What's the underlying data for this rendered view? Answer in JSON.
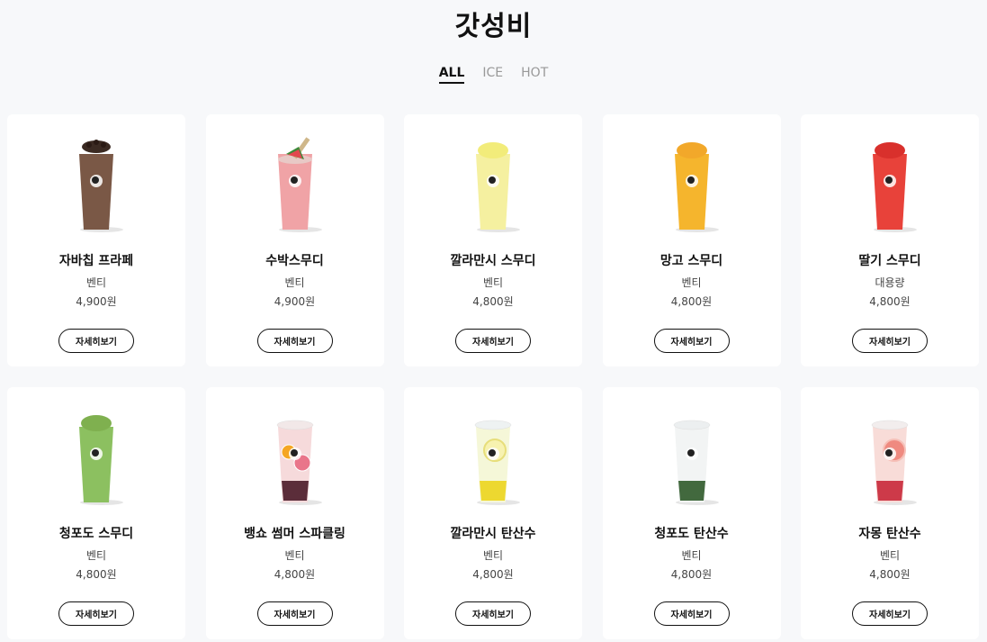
{
  "page": {
    "title": "갓성비"
  },
  "tabs": [
    {
      "label": "ALL",
      "active": true
    },
    {
      "label": "ICE",
      "active": false
    },
    {
      "label": "HOT",
      "active": false
    }
  ],
  "products": [
    {
      "name": "자바칩 프라페",
      "size": "벤티",
      "price": "4,900원",
      "button": "자세히보기",
      "icon": "frappe-cup-icon",
      "color": "#7a5846",
      "top": "#3b2a22",
      "accent": "#5c3e30"
    },
    {
      "name": "수박스무디",
      "size": "벤티",
      "price": "4,900원",
      "button": "자세히보기",
      "icon": "watermelon-smoothie-cup-icon",
      "color": "#f0a3a6",
      "top": "#e8c9c6",
      "accent": "#ef8a8e"
    },
    {
      "name": "깔라만시 스무디",
      "size": "벤티",
      "price": "4,800원",
      "button": "자세히보기",
      "icon": "calamansi-smoothie-cup-icon",
      "color": "#f5f0a0",
      "top": "#f2ec7a",
      "accent": "#efe88a"
    },
    {
      "name": "망고 스무디",
      "size": "벤티",
      "price": "4,800원",
      "button": "자세히보기",
      "icon": "mango-smoothie-cup-icon",
      "color": "#f5b52d",
      "top": "#f2a82a",
      "accent": "#f0a020"
    },
    {
      "name": "딸기 스무디",
      "size": "대용량",
      "price": "4,800원",
      "button": "자세히보기",
      "icon": "strawberry-smoothie-cup-icon",
      "color": "#e8423a",
      "top": "#d9302c",
      "accent": "#e2352e"
    },
    {
      "name": "청포도 스무디",
      "size": "벤티",
      "price": "4,800원",
      "button": "자세히보기",
      "icon": "green-grape-smoothie-cup-icon",
      "color": "#8cc060",
      "top": "#7fb04f",
      "accent": "#6fa040"
    },
    {
      "name": "뱅쇼 썸머 스파클링",
      "size": "벤티",
      "price": "4,800원",
      "button": "자세히보기",
      "icon": "vin-chaud-sparkling-cup-icon",
      "color": "#f6dadb",
      "top": "#f2e8e8",
      "accent": "#4a1a28"
    },
    {
      "name": "깔라만시 탄산수",
      "size": "벤티",
      "price": "4,800원",
      "button": "자세히보기",
      "icon": "calamansi-soda-cup-icon",
      "color": "#f5f7d8",
      "top": "#eef2f2",
      "accent": "#ecd41e"
    },
    {
      "name": "청포도 탄산수",
      "size": "벤티",
      "price": "4,800원",
      "button": "자세히보기",
      "icon": "green-grape-soda-cup-icon",
      "color": "#f2f4f4",
      "top": "#eceff0",
      "accent": "#2f5a2a"
    },
    {
      "name": "자몽 탄산수",
      "size": "벤티",
      "price": "4,800원",
      "button": "자세히보기",
      "icon": "grapefruit-soda-cup-icon",
      "color": "#f8dcd8",
      "top": "#f2eded",
      "accent": "#c8283a"
    }
  ]
}
